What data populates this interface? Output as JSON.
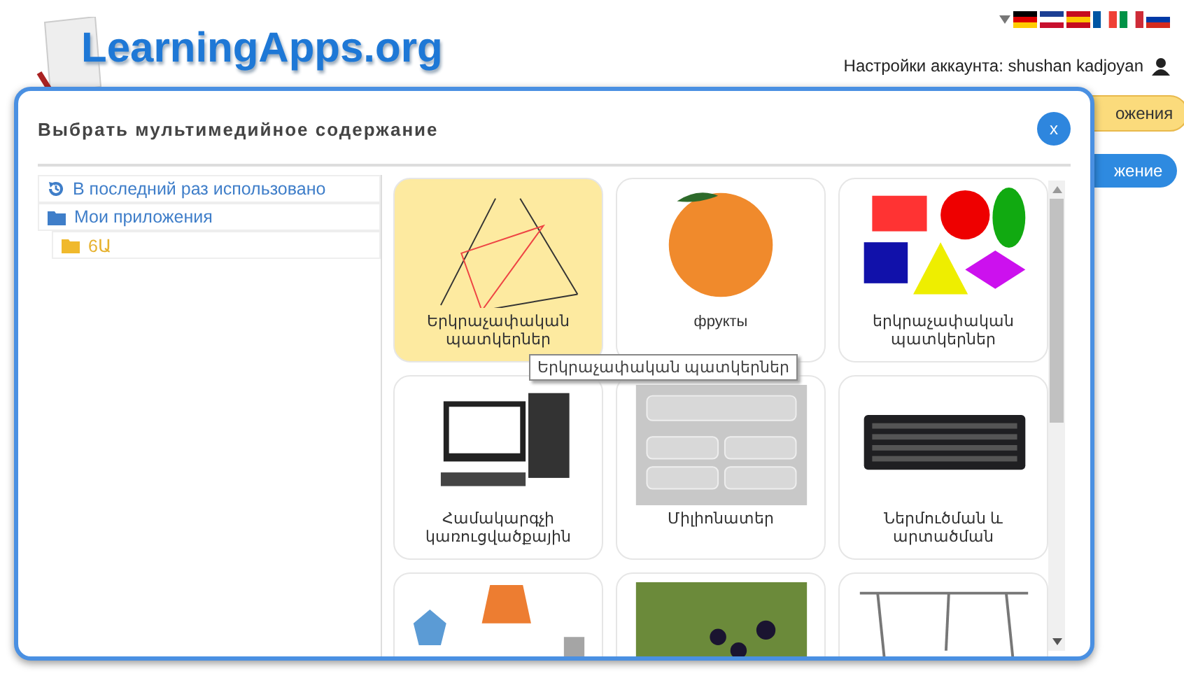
{
  "header": {
    "logo": "LearningApps.org",
    "account": "Настройки аккаунта: shushan kadjoyan"
  },
  "background_buttons": [
    {
      "label": "ожения",
      "kind": "yellow"
    },
    {
      "label": "жение",
      "kind": "blue"
    }
  ],
  "dialog": {
    "title": "Выбрать мультимедийное содержание",
    "close": "x"
  },
  "sidebar": {
    "items": [
      {
        "kind": "recent",
        "label": "В последний раз использовано"
      },
      {
        "kind": "folder",
        "label": "Мои приложения",
        "children": [
          {
            "kind": "folder",
            "label": "6Ա"
          }
        ]
      }
    ]
  },
  "cards": [
    {
      "kind": "geometry",
      "title": "Երկրաչափական պատկերներ",
      "selected": true
    },
    {
      "kind": "peach",
      "title": "фрукты",
      "selected": false
    },
    {
      "kind": "shapes",
      "title": "երկրաչափական պատկերներ",
      "selected": false
    },
    {
      "kind": "computer",
      "title": "Համակարգչի կառուցվածքային",
      "selected": false
    },
    {
      "kind": "quiz",
      "title": "Միլիոնատեր",
      "selected": false
    },
    {
      "kind": "keyboard",
      "title": "Ներմուծման և արտածման",
      "selected": false
    },
    {
      "kind": "polygons",
      "selected": false
    },
    {
      "kind": "berries",
      "selected": false
    },
    {
      "kind": "diagram",
      "selected": false
    }
  ],
  "tooltip": "Երկրաչափական պատկերներ"
}
